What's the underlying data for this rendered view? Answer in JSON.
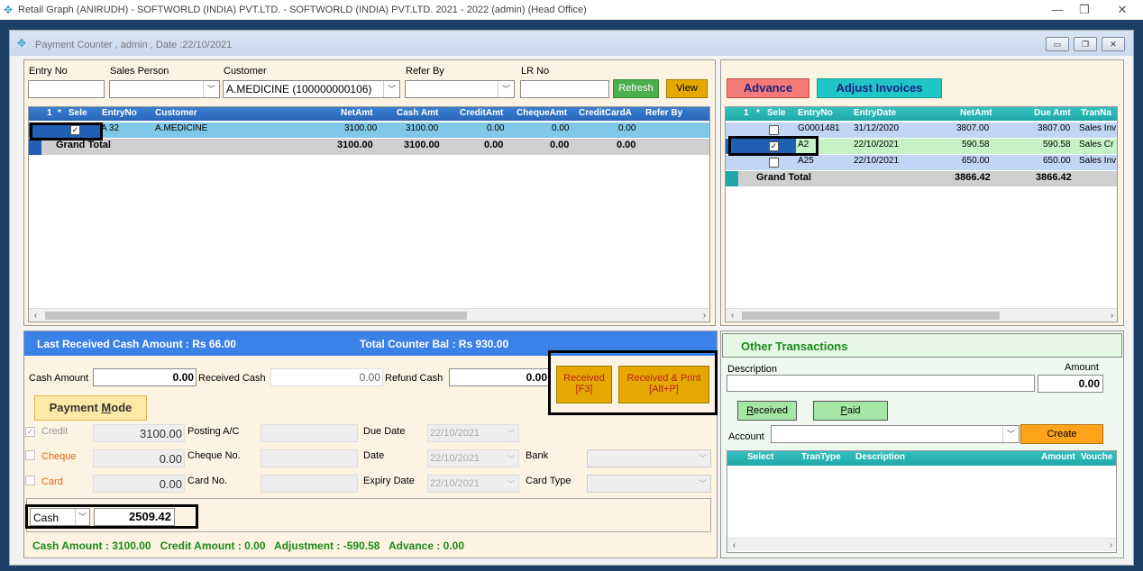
{
  "app_title": "Retail Graph (ANIRUDH) - SOFTWORLD (INDIA) PVT.LTD. - SOFTWORLD (INDIA) PVT.LTD.  2021 - 2022 (admin) (Head Office)",
  "window_controls": {
    "minimize": "—",
    "restore": "❐",
    "close": "✕"
  },
  "child_title": "Payment Counter , admin , Date :22/10/2021",
  "mdi_controls": {
    "minimize": "▭",
    "restore": "❐",
    "close": "✕"
  },
  "filters": {
    "entry_no_label": "Entry No",
    "sales_person_label": "Sales Person",
    "customer_label": "Customer",
    "customer_value": "A.MEDICINE (100000000106)",
    "refer_by_label": "Refer By",
    "lr_no_label": "LR No",
    "refresh": "Refresh",
    "view": "View"
  },
  "left_grid": {
    "headers": {
      "num": "1",
      "star": "*",
      "sele": "Sele",
      "entry": "EntryNo",
      "customer": "Customer",
      "netamt": "NetAmt",
      "cash": "Cash Amt",
      "credit": "CreditAmt",
      "cheque": "ChequeAmt",
      "cc": "CreditCardA",
      "refer": "Refer By"
    },
    "row": {
      "check": "✓",
      "entry": "A 32",
      "customer": "A.MEDICINE",
      "netamt": "3100.00",
      "cash": "3100.00",
      "credit": "0.00",
      "cheque": "0.00",
      "cc": "0.00"
    },
    "total": {
      "label": "Grand Total",
      "netamt": "3100.00",
      "cash": "3100.00",
      "credit": "0.00",
      "cheque": "0.00",
      "cc": "0.00"
    }
  },
  "right_top": {
    "advance": "Advance",
    "adjust": "Adjust Invoices",
    "headers": {
      "num": "1",
      "star": "*",
      "sele": "Sele",
      "entry": "EntryNo",
      "date": "EntryDate",
      "net": "NetAmt",
      "due": "Due Amt",
      "tran": "TranNa"
    },
    "rows": [
      {
        "check": "",
        "entry": "G0001481",
        "date": "31/12/2020",
        "net": "3807.00",
        "due": "3807.00",
        "tran": "Sales Inv"
      },
      {
        "check": "✓",
        "entry": "A2",
        "date": "22/10/2021",
        "net": "590.58",
        "due": "590.58",
        "tran": "Sales Cr"
      },
      {
        "check": "",
        "entry": "A25",
        "date": "22/10/2021",
        "net": "650.00",
        "due": "650.00",
        "tran": "Sales Inv"
      }
    ],
    "total": {
      "label": "Grand Total",
      "net": "3866.42",
      "due": "3866.42"
    }
  },
  "summary_bar": {
    "last_received": "Last Received Cash Amount : Rs 66.00",
    "counter_bal": "Total Counter Bal : Rs 930.00"
  },
  "cash_row": {
    "cash_amount_label": "Cash Amount",
    "cash_amount": "0.00",
    "received_cash_label": "Received Cash",
    "received_cash": "0.00",
    "refund_cash_label": "Refund Cash",
    "refund_cash": "0.00",
    "received_btn": "Received",
    "received_key": "[F3]",
    "received_print_btn": "Received & Print",
    "received_print_key": "[Alt+P]"
  },
  "payment_mode": {
    "label_pre": "Payment ",
    "label_u": "M",
    "label_post": "ode",
    "credit_label": "Credit",
    "credit_value": "3100.00",
    "credit_check": "✓",
    "cheque_label": "Cheque",
    "cheque_value": "0.00",
    "card_label": "Card",
    "card_value": "0.00",
    "posting_ac": "Posting A/C",
    "cheque_no": "Cheque No.",
    "card_no": "Card No.",
    "due_date_label": "Due Date",
    "due_date": "22/10/2021",
    "date_label": "Date",
    "date_value": "22/10/2021",
    "expiry_label": "Expiry Date",
    "expiry_value": "22/10/2021",
    "bank_label": "Bank",
    "card_type_label": "Card Type"
  },
  "cash_mode": {
    "mode": "Cash",
    "amount": "2509.42"
  },
  "footer_status": "Cash Amount : 3100.00   Credit Amount : 0.00   Adjustment : -590.58   Advance : 0.00",
  "other": {
    "title": "Other Transactions",
    "description_label": "Description",
    "amount_label": "Amount",
    "amount_value": "0.00",
    "received_u": "R",
    "received_rest": "eceived",
    "paid_u": "P",
    "paid_rest": "aid",
    "account_label": "Account",
    "create": "Create",
    "headers": {
      "select": "Select",
      "trantype": "TranType",
      "desc": "Description",
      "amount": "Amount",
      "voucher": "Vouche"
    }
  },
  "colors": {
    "accent_blue": "#2a66b8",
    "orange_btn": "#e4a800",
    "green_btn": "#4cae4c",
    "advance_red": "#f47a78",
    "adjust_cyan": "#20c5c5"
  }
}
